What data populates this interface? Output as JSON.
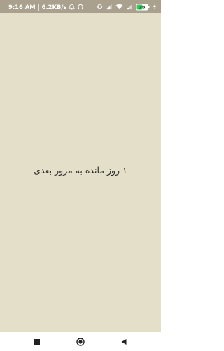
{
  "status_bar": {
    "time": "9:16 AM",
    "separator": "|",
    "network_speed": "6.2KB/s",
    "battery_level": "38",
    "icons_left": [
      "alarm-icon",
      "headphones-icon"
    ],
    "icons_right": [
      "vibrate-icon",
      "signal-icon",
      "wifi-icon",
      "signal-icon",
      "battery-icon",
      "charging-icon"
    ]
  },
  "main": {
    "message": "۱ روز مانده به مرور بعدی"
  },
  "nav_bar": {
    "buttons": [
      "recents-button",
      "home-button",
      "back-button"
    ]
  },
  "colors": {
    "background": "#e4dfc9",
    "status_bar": "#a9a18d",
    "battery_fill": "#34c759",
    "text": "#2b2b2b",
    "nav_icon": "#222222"
  }
}
